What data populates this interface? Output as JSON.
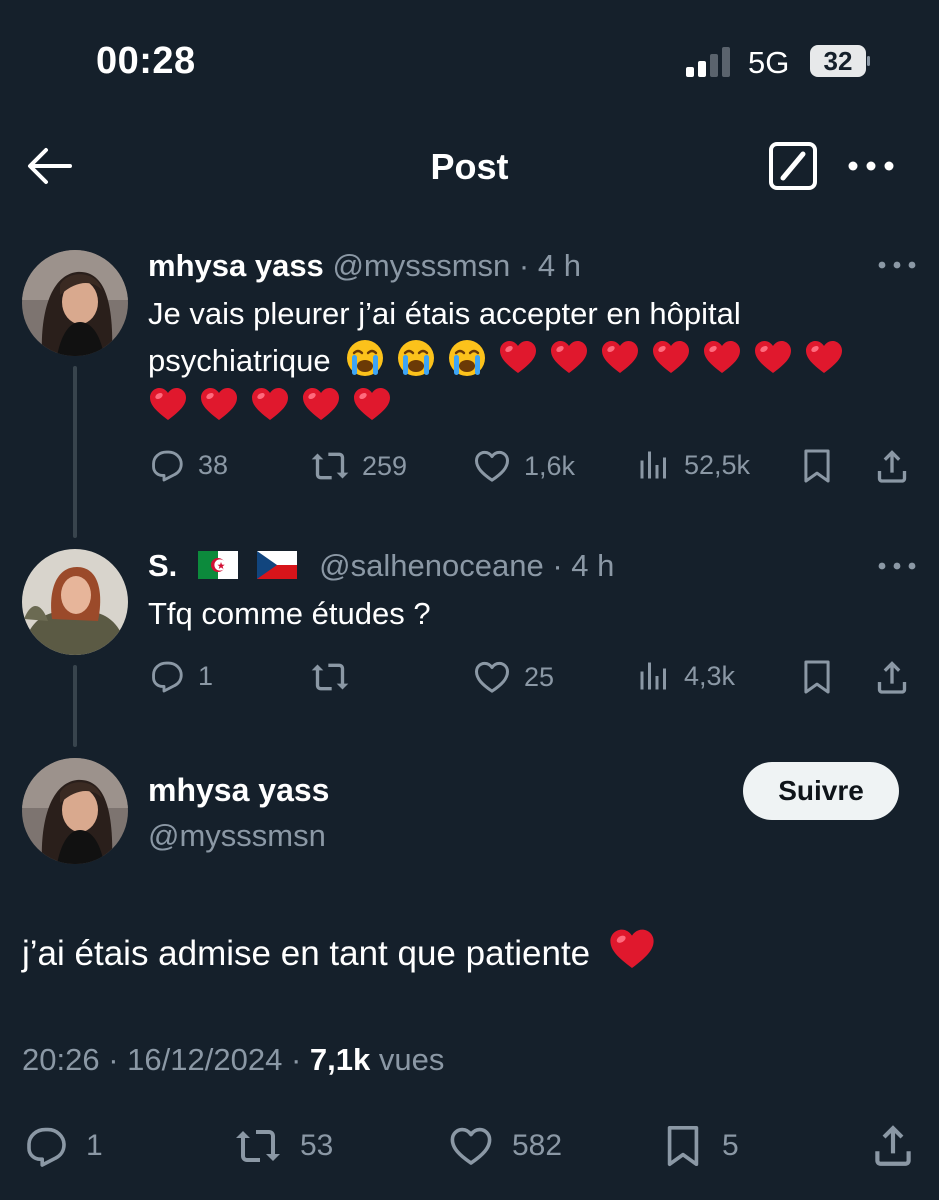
{
  "status_bar": {
    "time": "00:28",
    "network": "5G",
    "battery": "32"
  },
  "header": {
    "title": "Post",
    "back_icon": "arrow-left-icon",
    "grok_icon": "grok-icon",
    "more_icon": "more-horizontal-icon"
  },
  "tweet1": {
    "name": "mhysa yass",
    "handle": "@mysssmsn",
    "sep": "·",
    "time": "4 h",
    "text_line1": "Je vais pleurer j’ai étais accepter en hôpital",
    "text_line2": "psychiatrique",
    "emoji_line2": [
      "crying-face",
      "crying-face",
      "crying-face",
      "red-heart",
      "red-heart",
      "red-heart",
      "red-heart",
      "red-heart",
      "red-heart",
      "red-heart"
    ],
    "emoji_line3": [
      "red-heart",
      "red-heart",
      "red-heart",
      "red-heart",
      "red-heart"
    ],
    "stats": {
      "replies": "38",
      "reposts": "259",
      "likes": "1,6k",
      "views": "52,5k"
    }
  },
  "tweet2": {
    "name": "S.",
    "flags": [
      "flag-algeria",
      "flag-czechia"
    ],
    "handle": "@salhenoceane",
    "sep": "·",
    "time": "4 h",
    "text": "Tfq comme études ?",
    "stats": {
      "replies": "1",
      "reposts": "",
      "likes": "25",
      "views": "4,3k"
    }
  },
  "main_tweet": {
    "name": "mhysa yass",
    "handle": "@mysssmsn",
    "follow_label": "Suivre",
    "text": "j’ai étais admise en tant que patiente",
    "text_emoji": "red-heart",
    "time": "20:26",
    "sep": "·",
    "date": "16/12/2024",
    "views_count": "7,1k",
    "views_label": "vues",
    "stats": {
      "replies": "1",
      "reposts": "53",
      "likes": "582",
      "bookmarks": "5"
    }
  },
  "colors": {
    "background": "#15202b",
    "text": "#ffffff",
    "secondary": "#8b98a5",
    "heart": "#e0245e",
    "line": "#38444d",
    "button": "#eff3f4"
  }
}
